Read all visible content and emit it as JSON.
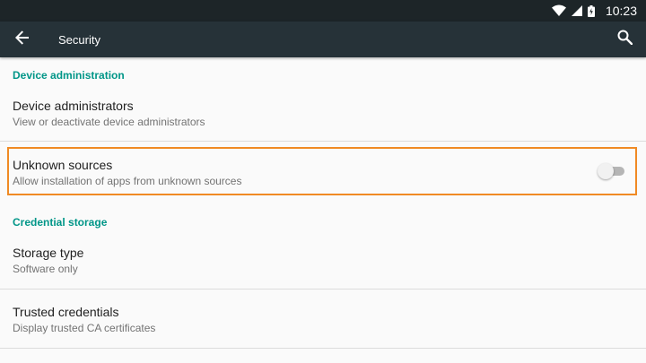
{
  "status_bar": {
    "time": "10:23",
    "icons": [
      "wifi-icon",
      "cell-signal-icon",
      "battery-icon"
    ]
  },
  "app_bar": {
    "title": "Security",
    "back_icon": "arrow-back-icon",
    "search_icon": "search-icon"
  },
  "sections": {
    "device_admin": {
      "header": "Device administration",
      "device_administrators": {
        "title": "Device administrators",
        "summary": "View or deactivate device administrators"
      },
      "unknown_sources": {
        "title": "Unknown sources",
        "summary": "Allow installation of apps from unknown sources",
        "enabled": false
      }
    },
    "credential_storage": {
      "header": "Credential storage",
      "storage_type": {
        "title": "Storage type",
        "summary": "Software only"
      },
      "trusted_credentials": {
        "title": "Trusted credentials",
        "summary": "Display trusted CA certificates"
      }
    }
  },
  "colors": {
    "status_bar": "#1d2528",
    "app_bar": "#263238",
    "accent": "#009688",
    "highlight": "#f08a24"
  }
}
